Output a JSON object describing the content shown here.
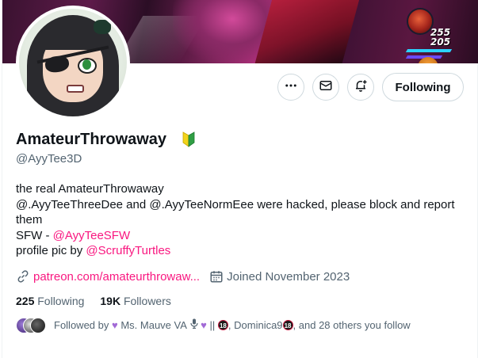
{
  "profile": {
    "display_name": "AmateurThrowaway",
    "badge_icon": "beginner-symbol-icon",
    "handle": "@AyyTee3D"
  },
  "actions": {
    "more_icon": "more-icon",
    "message_icon": "envelope-icon",
    "notify_icon": "bell-plus-icon",
    "following_label": "Following"
  },
  "bio": {
    "line1": "the real AmateurThrowaway",
    "line2": "@.AyyTeeThreeDee and @.AyyTeeNormEee were hacked, please block and report them",
    "line3_prefix": "SFW - ",
    "line3_link": "@AyyTeeSFW",
    "line4_prefix": "profile pic by ",
    "line4_link": "@ScruffyTurtles"
  },
  "meta": {
    "website": "patreon.com/amateurthrowaw...",
    "joined": "Joined November 2023"
  },
  "stats": {
    "following_count": "225",
    "following_label": "Following",
    "followers_count": "19K",
    "followers_label": "Followers"
  },
  "followed_by": {
    "prefix": "Followed by",
    "user1": "Ms. Mauve VA",
    "separator": "||",
    "age_label": "18",
    "user2": "Dominica9",
    "suffix": ", and 28 others you follow"
  },
  "banner_hud": {
    "value1": "255",
    "value2": "205"
  },
  "colors": {
    "accent_link": "#f91880",
    "secondary_text": "#536471",
    "primary_text": "#0f1419",
    "border": "#cfd9de"
  }
}
